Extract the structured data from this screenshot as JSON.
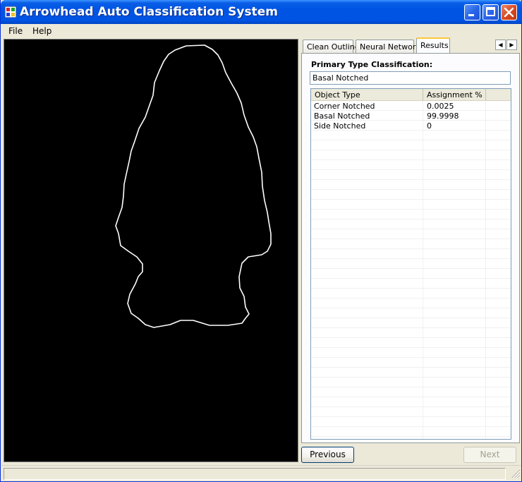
{
  "window": {
    "title": "Arrowhead Auto Classification System",
    "colors": {
      "titlebar": "#0054e3",
      "canvas_bg": "#000000",
      "outline": "#ffffff"
    }
  },
  "menu": {
    "file": "File",
    "help": "Help"
  },
  "tabs": [
    {
      "label": "Clean Outline",
      "selected": false
    },
    {
      "label": "Neural Network",
      "selected": false
    },
    {
      "label": "Results",
      "selected": true
    }
  ],
  "results": {
    "primary_label": "Primary Type Classification:",
    "primary_value": "Basal Notched",
    "columns": [
      "Object Type",
      "Assignment %"
    ],
    "rows": [
      {
        "type": "Corner Notched",
        "assignment": "0.0025"
      },
      {
        "type": "Basal Notched",
        "assignment": "99.9998"
      },
      {
        "type": "Side Notched",
        "assignment": "0"
      }
    ]
  },
  "buttons": {
    "previous": "Previous",
    "next": "Next"
  }
}
